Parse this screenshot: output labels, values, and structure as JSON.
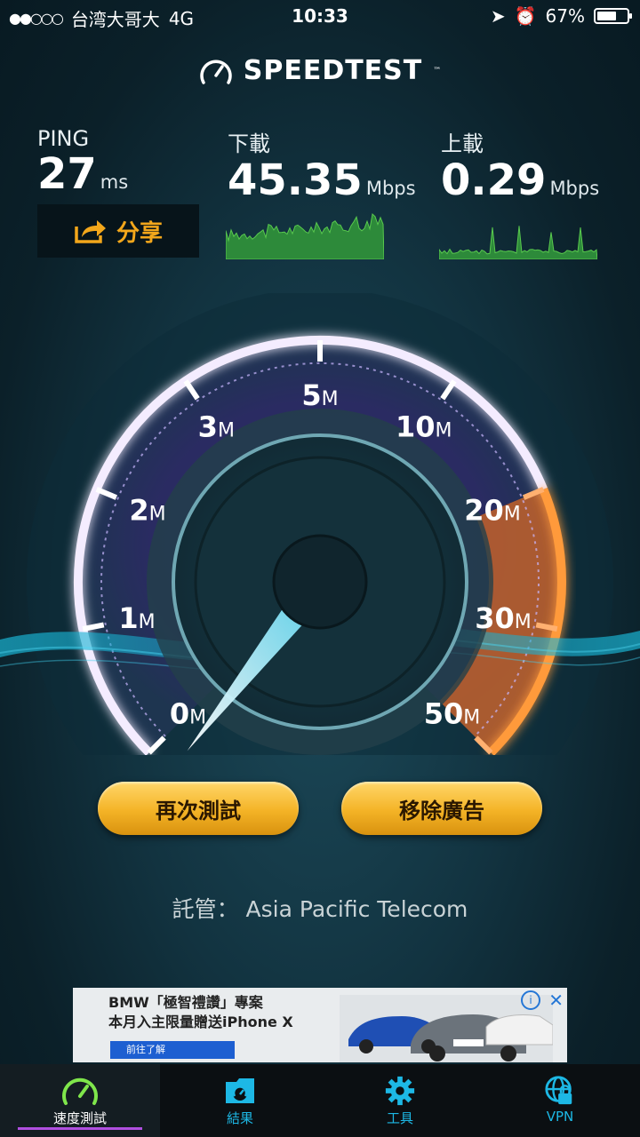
{
  "status_bar": {
    "carrier": "台湾大哥大",
    "network": "4G",
    "time": "10:33",
    "battery": "67%",
    "battery_level": 0.67
  },
  "app": {
    "logo_text": "SPEEDTEST"
  },
  "metrics": {
    "ping": {
      "label": "PING",
      "value": "27",
      "unit": "ms"
    },
    "download": {
      "label": "下載",
      "value": "45.35",
      "unit": "Mbps"
    },
    "upload": {
      "label": "上載",
      "value": "0.29",
      "unit": "Mbps"
    }
  },
  "share_button": {
    "label": "分享"
  },
  "gauge": {
    "ticks": [
      "0M",
      "1M",
      "2M",
      "3M",
      "5M",
      "10M",
      "20M",
      "30M",
      "50M"
    ],
    "needle_value": "0M",
    "highlight_range": [
      "20M",
      "50M"
    ]
  },
  "buttons": {
    "retest": "再次測試",
    "remove_ads": "移除廣告"
  },
  "host": {
    "label": "託管：",
    "name": "Asia Pacific Telecom"
  },
  "ad": {
    "line1": "BMW「極智禮讚」專案",
    "line2": "本月入主限量贈送iPhone X",
    "cta": "前往了解"
  },
  "tabs": [
    {
      "label": "速度測試",
      "icon": "speedometer-icon",
      "active": true
    },
    {
      "label": "結果",
      "icon": "results-icon",
      "active": false
    },
    {
      "label": "工具",
      "icon": "gear-icon",
      "active": false
    },
    {
      "label": "VPN",
      "icon": "vpn-icon",
      "active": false
    }
  ],
  "colors": {
    "accent": "#1db8e5",
    "button": "#f4b326",
    "gauge_ring": "#b98ef2",
    "gauge_hot": "#f58a2a"
  }
}
